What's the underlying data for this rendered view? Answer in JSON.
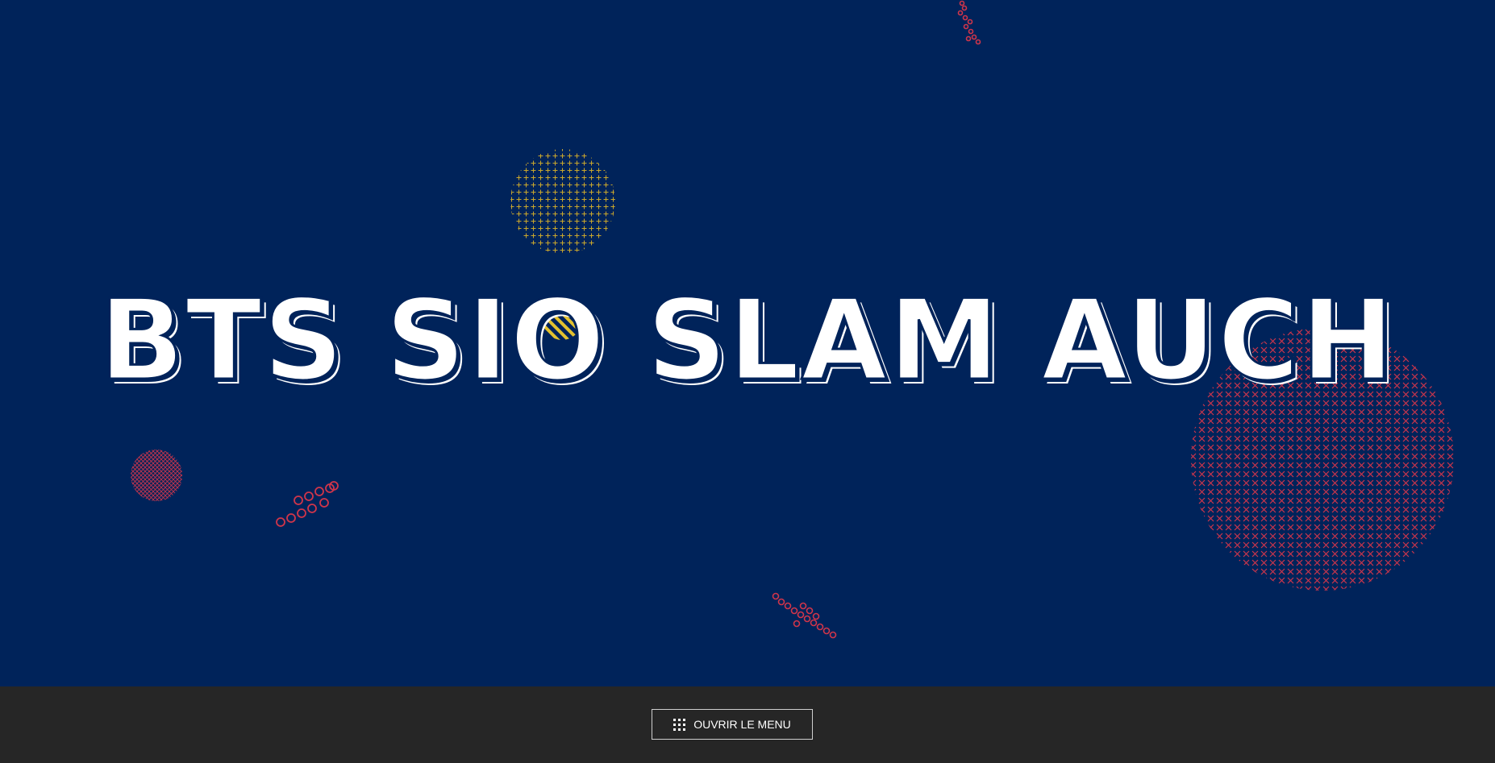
{
  "hero": {
    "title": "BTS SIO SLAM AUCH"
  },
  "footer": {
    "menu_button_label": "OUVRIR LE MENU",
    "menu_button_icon": "grid-menu-icon"
  },
  "colors": {
    "background": "#00235a",
    "footer": "#262626",
    "title": "#ffffff",
    "accent_red": "#d0354a",
    "accent_yellow": "#c9a82c"
  }
}
